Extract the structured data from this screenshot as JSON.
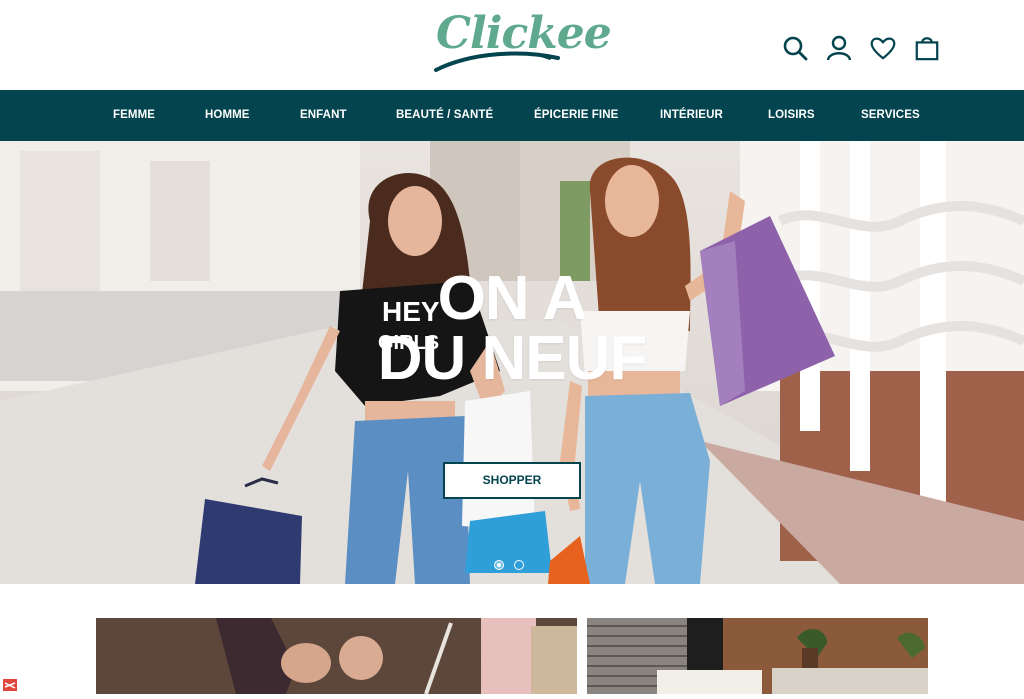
{
  "brand": {
    "name": "Clickee",
    "color": "#5fa98e"
  },
  "header": {
    "icons": [
      "search-icon",
      "user-icon",
      "heart-icon",
      "bag-icon"
    ]
  },
  "nav": {
    "items": [
      {
        "label": "FEMME"
      },
      {
        "label": "HOMME"
      },
      {
        "label": "ENFANT"
      },
      {
        "label": "BEAUTÉ / SANTÉ"
      },
      {
        "label": "ÉPICERIE FINE"
      },
      {
        "label": "INTÉRIEUR"
      },
      {
        "label": "LOISIRS"
      },
      {
        "label": "SERVICES"
      }
    ],
    "background": "#04444f"
  },
  "hero": {
    "title_line1": "ON A",
    "title_line2": "DU NEUF",
    "cta_label": "SHOPPER",
    "shirt_text1": "HEY",
    "shirt_text2": "GIRLS",
    "slides_total": 2,
    "active_slide": 1
  },
  "colors": {
    "accent": "#04444f",
    "white": "#ffffff"
  }
}
